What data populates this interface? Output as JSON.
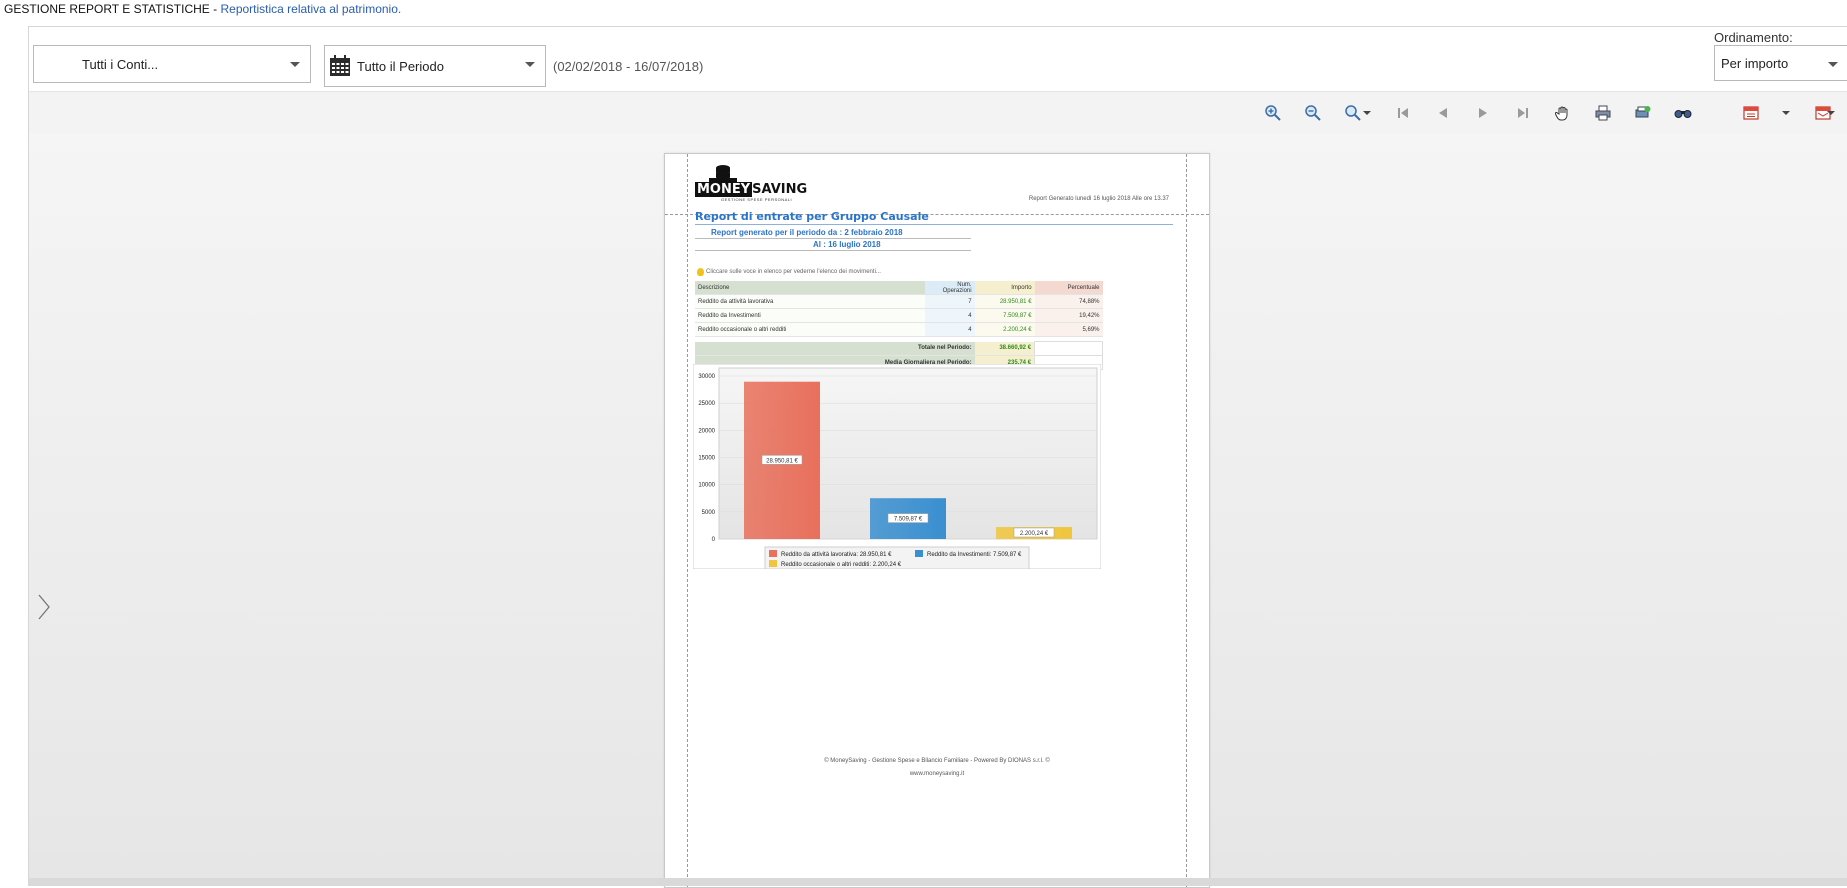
{
  "window": {
    "title": "GESTIONE REPORT E STATISTICHE - ",
    "subtitle": "Reportistica relativa al patrimonio."
  },
  "filters": {
    "accounts": "Tutti i Conti...",
    "period": "Tutto il Periodo",
    "date_range": "(02/02/2018 - 16/07/2018)",
    "order_label": "Ordinamento:",
    "order_value": "Per importo"
  },
  "toolbar": {
    "icons": [
      "zoom-in-icon",
      "zoom-out-icon",
      "zoom-icon",
      "first-page-icon",
      "previous-page-icon",
      "next-page-icon",
      "last-page-icon",
      "hand-tool-icon",
      "print-icon",
      "page-setup-icon",
      "find-icon",
      "export-icon",
      "send-icon"
    ]
  },
  "report": {
    "logo_text_a": "MONEY",
    "logo_text_b": "SAVING",
    "logo_sub": "GESTIONE SPESE PERSONALI",
    "generated": "Report Generato lunedì 16 luglio 2018 Alle ore 13.37",
    "title": "Report di entrate per Gruppo Causale",
    "period_from": "Report generato per il periodo da : 2 febbraio 2018",
    "period_to": "Al : 16 luglio 2018",
    "hint": "Cliccare sulle voce in elenco per vederne l'elenco dei movimenti...",
    "table": {
      "headers": [
        "Descrizione",
        "Num. Operazioni",
        "Importo",
        "Percentuale"
      ],
      "rows": [
        [
          "Reddito da attività lavorativa",
          "7",
          "28.950,81 €",
          "74,88%"
        ],
        [
          "Reddito da Investimenti",
          "4",
          "7.509,87 €",
          "19,42%"
        ],
        [
          "Reddito occasionale o altri redditi",
          "4",
          "2.200,24 €",
          "5,69%"
        ]
      ],
      "total_label": "Totale nel Periodo:",
      "total_value": "38.660,92 €",
      "avg_label": "Media Giornaliera nel Periodo:",
      "avg_value": "235,74 €"
    },
    "footer_line1": "© MoneySaving - Gestione Spese e Bilancio Familiare - Powered By DIONAS s.r.l. ©",
    "footer_line2": "www.moneysaving.it"
  },
  "chart_data": {
    "type": "bar",
    "categories": [
      "Reddito da attività lavorativa",
      "Reddito da Investimenti",
      "Reddito occasionale o altri redditi"
    ],
    "values": [
      28950.81,
      7509.87,
      2200.24
    ],
    "value_labels": [
      "28.950,81 €",
      "7.509,87 €",
      "2.200,24 €"
    ],
    "colors": [
      "#e8705c",
      "#3a8fd0",
      "#f0c63e"
    ],
    "yticks": [
      0,
      5000,
      10000,
      15000,
      20000,
      25000,
      30000
    ],
    "ylim": [
      0,
      30000
    ],
    "legend": [
      "Reddito da attività lavorativa: 28.950,81 €",
      "Reddito da Investimenti: 7.509,87 €",
      "Reddito occasionale o altri redditi: 2.200,24 €"
    ],
    "legend_position": "bottom",
    "grid": true
  }
}
